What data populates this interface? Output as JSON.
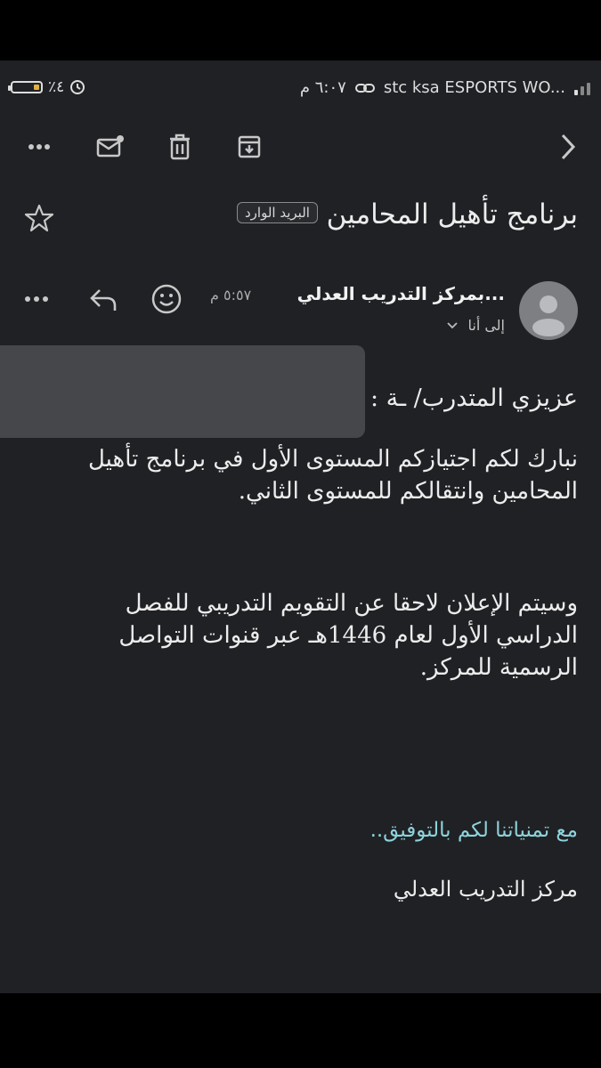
{
  "status_bar": {
    "battery": "٪٤",
    "time": "٦:٠٧ م",
    "carrier": "stc ksa ESPORTS WO..."
  },
  "toolbar": {
    "icons": [
      "more-icon",
      "mark-unread-icon",
      "delete-icon",
      "archive-icon",
      "back-icon"
    ]
  },
  "email": {
    "subject": "برنامج تأهيل المحامين",
    "label_chip": "البريد الوارد",
    "sender": "...بمركز التدريب العدلي",
    "time": "٥:٥٧ م",
    "recipients": "إلى أنا",
    "greeting": "عزيزي المتدرب/ ـة :",
    "paragraph1_line1": "نبارك لكم اجتيازكم المستوى الأول في برنامج تأهيل",
    "paragraph1_line2": "المحامين وانتقالكم للمستوى الثاني.",
    "paragraph2_line1": "وسيتم الإعلان لاحقا عن التقويم التدريبي للفصل",
    "paragraph2_line2": "الدراسي الأول لعام 1446هـ عبر قنوات التواصل",
    "paragraph2_line3": "الرسمية للمركز.",
    "closing": "مع تمنياتنا لكم بالتوفيق..",
    "signature": "مركز التدريب العدلي"
  },
  "colors": {
    "background": "#202124",
    "closing_text": "#8ed3dc",
    "battery": "#e0b040"
  }
}
